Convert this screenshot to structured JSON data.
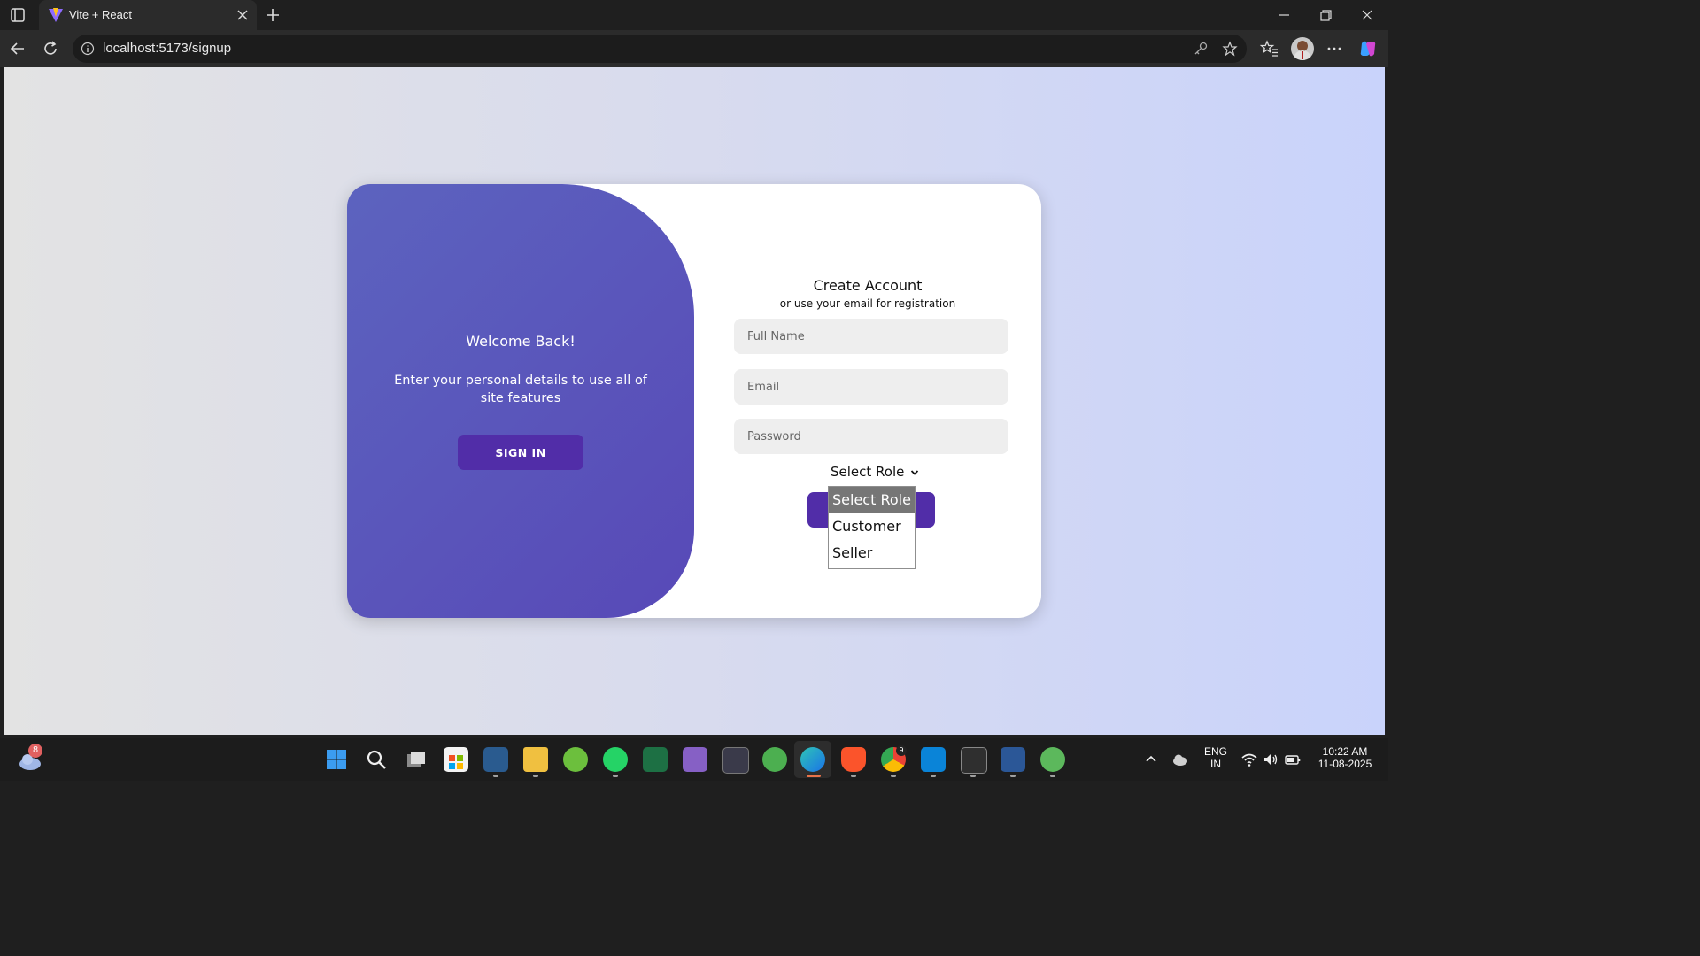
{
  "browser": {
    "tab_title": "Vite + React",
    "url": "localhost:5173/signup"
  },
  "welcome_panel": {
    "title": "Welcome Back!",
    "description": "Enter your personal details to use all of site features",
    "signin_label": "SIGN IN"
  },
  "signup_form": {
    "heading": "Create Account",
    "subheading": "or use your email for registration",
    "name_placeholder": "Full Name",
    "email_placeholder": "Email",
    "password_placeholder": "Password",
    "role_selected": "Select Role",
    "role_options": [
      "Select Role",
      "Customer",
      "Seller"
    ],
    "accent_color": "#512da8"
  },
  "taskbar": {
    "weather_badge": "8",
    "chrome_badge": "9",
    "language": "ENG",
    "region": "IN",
    "time": "10:22 AM",
    "date": "11-08-2025"
  }
}
